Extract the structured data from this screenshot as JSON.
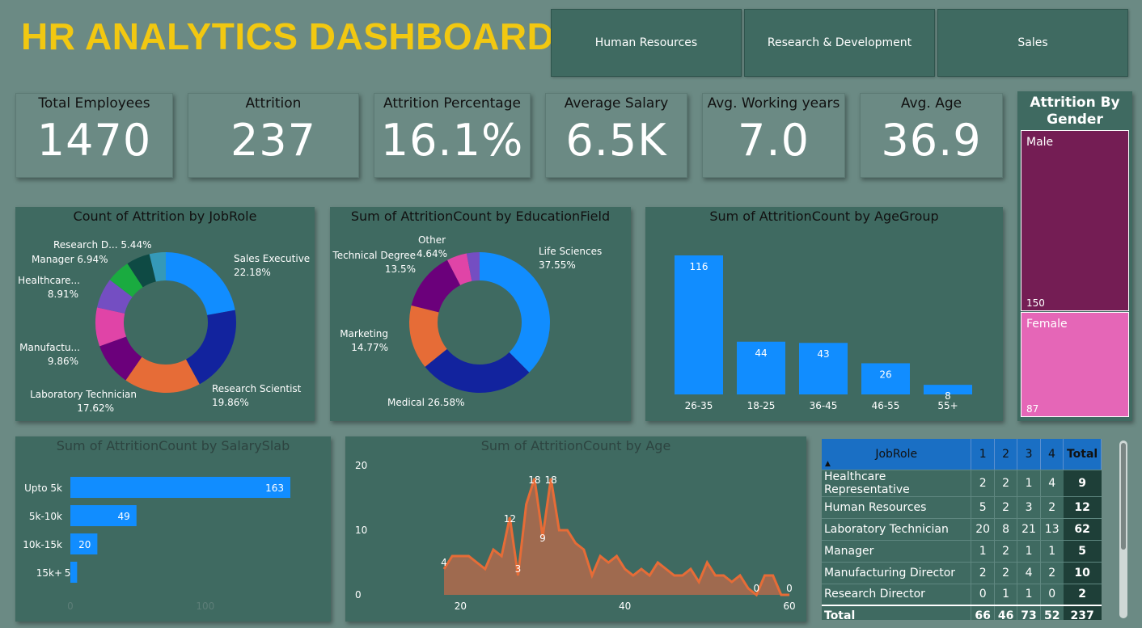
{
  "header": {
    "title": "HR ANALYTICS DASHBOARD"
  },
  "slicers": [
    "Human Resources",
    "Research & Development",
    "Sales"
  ],
  "kpis": [
    {
      "label": "Total Employees",
      "value": "1470"
    },
    {
      "label": "Attrition",
      "value": "237"
    },
    {
      "label": "Attrition Percentage",
      "value": "16.1%"
    },
    {
      "label": "Average Salary",
      "value": "6.5K"
    },
    {
      "label": "Avg. Working years",
      "value": "7.0"
    },
    {
      "label": "Avg. Age",
      "value": "36.9"
    }
  ],
  "colors": {
    "background": "#6B8A84",
    "panel": "#3F6A61",
    "title": "#F2C811",
    "bar": "#118DFF",
    "male": "#741D54",
    "female": "#E566B7",
    "area": "#E66C37"
  },
  "chart_data": [
    {
      "type": "pie",
      "donut": true,
      "title": "Count of Attrition by JobRole",
      "slices": [
        {
          "label": "Sales Executive",
          "pct": "22.18%",
          "value": 22.18,
          "color": "#118DFF"
        },
        {
          "label": "Research Scientist",
          "pct": "19.86%",
          "value": 19.86,
          "color": "#12239E"
        },
        {
          "label": "Laboratory Technician",
          "pct": "17.62%",
          "value": 17.62,
          "color": "#E66C37"
        },
        {
          "label": "Manufactu...",
          "pct": "9.86%",
          "value": 9.86,
          "color": "#6B007B"
        },
        {
          "label": "Healthcare...",
          "pct": "8.91%",
          "value": 8.91,
          "color": "#E044A7"
        },
        {
          "label": "Manager",
          "pct": "6.94%",
          "value": 6.94,
          "color": "#744EC2"
        },
        {
          "label": "Research D...",
          "pct": "5.44%",
          "value": 5.44,
          "color": "#1AAB40"
        },
        {
          "label": "",
          "pct": "",
          "value": 5.44,
          "color": "#0E4A44"
        },
        {
          "label": "",
          "pct": "",
          "value": 3.75,
          "color": "#3599B8"
        }
      ]
    },
    {
      "type": "pie",
      "donut": true,
      "title": "Sum of AttritionCount by EducationField",
      "slices": [
        {
          "label": "Life Sciences",
          "pct": "37.55%",
          "value": 37.55,
          "color": "#118DFF"
        },
        {
          "label": "Medical",
          "pct": "26.58%",
          "value": 26.58,
          "color": "#12239E"
        },
        {
          "label": "Marketing",
          "pct": "14.77%",
          "value": 14.77,
          "color": "#E66C37"
        },
        {
          "label": "Technical Degree",
          "pct": "13.5%",
          "value": 13.5,
          "color": "#6B007B"
        },
        {
          "label": "Other",
          "pct": "4.64%",
          "value": 4.64,
          "color": "#E044A7"
        },
        {
          "label": "",
          "pct": "",
          "value": 2.96,
          "color": "#744EC2"
        }
      ]
    },
    {
      "type": "bar",
      "title": "Sum of AttritionCount by AgeGroup",
      "categories": [
        "26-35",
        "18-25",
        "36-45",
        "46-55",
        "55+"
      ],
      "values": [
        116,
        44,
        43,
        26,
        8
      ]
    },
    {
      "type": "bar",
      "orientation": "horizontal",
      "title": "Sum of AttritionCount by SalarySlab",
      "categories": [
        "Upto 5k",
        "5k-10k",
        "10k-15k",
        "15k+"
      ],
      "values": [
        163,
        49,
        20,
        5
      ],
      "xticks": [
        "0",
        "100"
      ],
      "xlim": [
        0,
        200
      ]
    },
    {
      "type": "area",
      "title": "Sum of AttritionCount by Age",
      "x": [
        18,
        19,
        20,
        21,
        22,
        23,
        24,
        25,
        26,
        27,
        28,
        29,
        30,
        31,
        32,
        33,
        34,
        35,
        36,
        37,
        38,
        39,
        40,
        41,
        42,
        43,
        44,
        45,
        46,
        47,
        48,
        49,
        50,
        51,
        52,
        53,
        54,
        55,
        56,
        57,
        58,
        59,
        60
      ],
      "y": [
        4,
        6,
        6,
        6,
        5,
        4,
        7,
        6,
        12,
        3,
        14,
        18,
        9,
        18,
        10,
        10,
        8,
        7,
        3,
        6,
        5,
        6,
        4,
        3,
        4,
        3,
        5,
        4,
        3,
        3,
        4,
        2,
        5,
        3,
        3,
        2,
        3,
        1,
        0,
        3,
        3,
        0,
        0
      ],
      "point_labels": [
        {
          "x": 18,
          "label": "4"
        },
        {
          "x": 26,
          "label": "12"
        },
        {
          "x": 27,
          "label": "3"
        },
        {
          "x": 29,
          "label": "18"
        },
        {
          "x": 30,
          "label": "9"
        },
        {
          "x": 31,
          "label": "18"
        },
        {
          "x": 56,
          "label": "0"
        },
        {
          "x": 60,
          "label": "0"
        }
      ],
      "yticks": [
        "0",
        "10",
        "20"
      ],
      "xticks": [
        "20",
        "40",
        "60"
      ],
      "ylim": [
        0,
        20
      ],
      "xlim": [
        17,
        60
      ]
    },
    {
      "type": "bar",
      "stacked": true,
      "title": "Attrition By Gender",
      "categories": [
        "Male",
        "Female"
      ],
      "values": [
        150,
        87
      ]
    },
    {
      "type": "table",
      "columns": [
        "JobRole",
        "1",
        "2",
        "3",
        "4",
        "Total"
      ],
      "rows": [
        [
          "Healthcare Representative",
          "2",
          "2",
          "1",
          "4",
          "9"
        ],
        [
          "Human Resources",
          "5",
          "2",
          "3",
          "2",
          "12"
        ],
        [
          "Laboratory Technician",
          "20",
          "8",
          "21",
          "13",
          "62"
        ],
        [
          "Manager",
          "1",
          "2",
          "1",
          "1",
          "5"
        ],
        [
          "Manufacturing Director",
          "2",
          "2",
          "4",
          "2",
          "10"
        ],
        [
          "Research Director",
          "0",
          "1",
          "1",
          "0",
          "2"
        ]
      ],
      "total": [
        "Total",
        "66",
        "46",
        "73",
        "52",
        "237"
      ]
    }
  ]
}
